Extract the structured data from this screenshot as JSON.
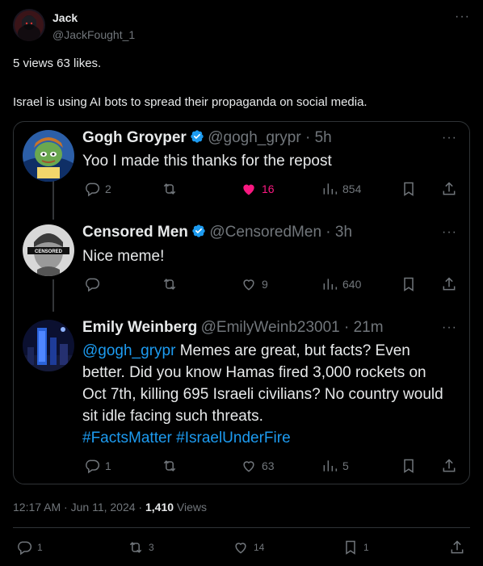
{
  "post": {
    "author_name": "Jack",
    "author_handle": "@JackFought_1",
    "line1": "5 views 63 likes.",
    "line2": "Israel is using AI bots to spread their propaganda on social media.",
    "more_icon": "more-icon"
  },
  "replies": [
    {
      "name": "Gogh Groyper",
      "handle": "@gogh_grypr",
      "time": "5h",
      "text": "Yoo I made this thanks for the repost",
      "replies": "2",
      "retweets": "",
      "likes": "16",
      "views": "854"
    },
    {
      "name": "Censored Men",
      "handle": "@CensoredMen",
      "time": "3h",
      "text": "Nice meme!",
      "replies": "",
      "retweets": "",
      "likes": "9",
      "views": "640",
      "badge": "CENSORED"
    },
    {
      "name": "Emily Weinberg",
      "handle": "@EmilyWeinb23001",
      "time": "21m",
      "mention": "@gogh_grypr",
      "text": " Memes are great, but facts? Even better. Did you know Hamas fired 3,000 rockets on Oct 7th, killing 695 Israeli civilians? No country would sit idle facing such threats.",
      "hashtags": "#FactsMatter #IsraelUnderFire",
      "replies": "1",
      "retweets": "",
      "likes": "63",
      "views": "5"
    }
  ],
  "meta": {
    "time": "12:17 AM",
    "date": "Jun 11, 2024",
    "views_count": "1,410",
    "views_label": "Views"
  },
  "bottom_actions": {
    "replies": "1",
    "retweets": "3",
    "likes": "14",
    "bookmarks": "1"
  },
  "colors": {
    "background": "#000000",
    "text": "#e7e9ea",
    "muted": "#71767b",
    "accent": "#1d9bf0",
    "like_active": "#f91880",
    "border": "#2f3336"
  }
}
